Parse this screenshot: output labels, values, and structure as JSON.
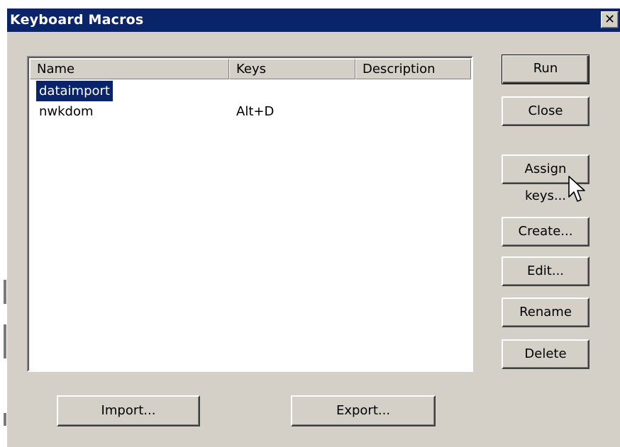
{
  "dialog": {
    "title": "Keyboard Macros",
    "close_label": "✕"
  },
  "list": {
    "columns": [
      "Name",
      "Keys",
      "Description"
    ],
    "rows": [
      {
        "name": "dataimport",
        "keys": "",
        "description": "",
        "selected": true
      },
      {
        "name": "nwkdom",
        "keys": "Alt+D",
        "description": "",
        "selected": false
      }
    ]
  },
  "buttons": {
    "run": "Run",
    "close": "Close",
    "assign_keys": "Assign keys...",
    "create": "Create...",
    "edit": "Edit...",
    "rename": "Rename",
    "delete": "Delete",
    "import": "Import...",
    "export": "Export..."
  },
  "colors": {
    "titlebar": "#0a246a",
    "face": "#d4d0c8",
    "selection": "#0a246a"
  },
  "icons": {
    "close": "close-icon",
    "cursor": "mouse-pointer-icon"
  }
}
